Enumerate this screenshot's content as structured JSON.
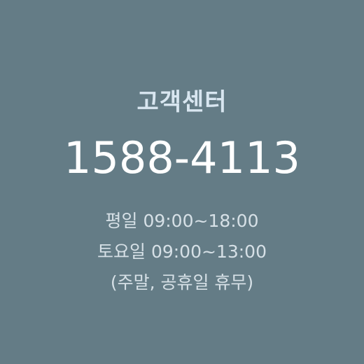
{
  "customer_center": {
    "title": "고객센터",
    "phone": "1588-4113",
    "hours": [
      "평일 09:00~18:00",
      "토요일 09:00~13:00",
      "(주말, 공휴일 휴무)"
    ]
  }
}
